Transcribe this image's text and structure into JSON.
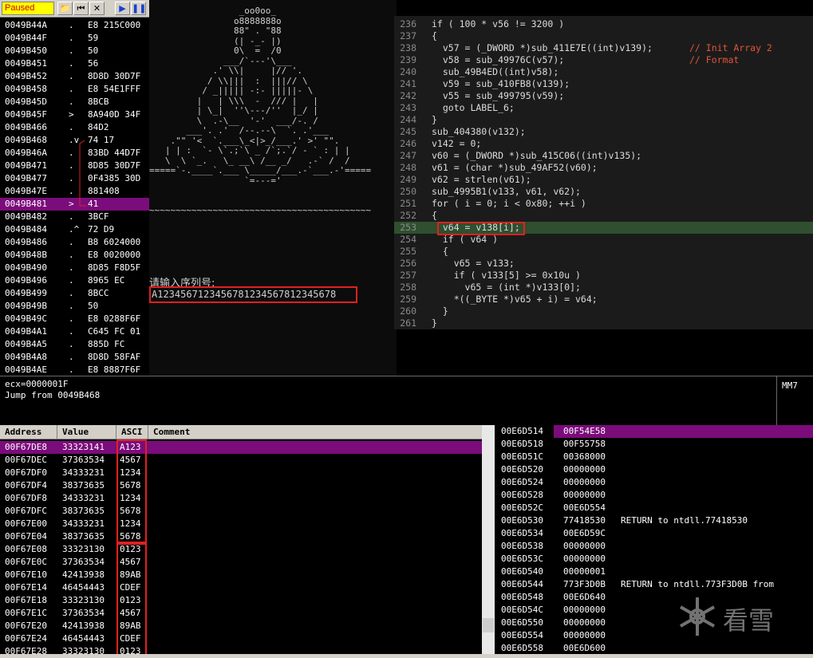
{
  "toolbar": {
    "status": "Paused",
    "icons": [
      "open-icon",
      "rewind-icon",
      "close-icon",
      "run-icon",
      "pause-icon"
    ]
  },
  "disasm": [
    {
      "addr": "0049B44A",
      "mark": ".",
      "bytes": "E8 215C000"
    },
    {
      "addr": "0049B44F",
      "mark": ".",
      "bytes": "59"
    },
    {
      "addr": "0049B450",
      "mark": ".",
      "bytes": "50"
    },
    {
      "addr": "0049B451",
      "mark": ".",
      "bytes": "56"
    },
    {
      "addr": "0049B452",
      "mark": ".",
      "bytes": "8D8D 30D7F"
    },
    {
      "addr": "0049B458",
      "mark": ".",
      "bytes": "E8 54E1FFF"
    },
    {
      "addr": "0049B45D",
      "mark": ".",
      "bytes": "8BCB"
    },
    {
      "addr": "0049B45F",
      "mark": ">",
      "bytes": "8A940D 34F"
    },
    {
      "addr": "0049B466",
      "mark": ".",
      "bytes": "84D2"
    },
    {
      "addr": "0049B468",
      "mark": ".v",
      "bytes": "74 17"
    },
    {
      "addr": "0049B46A",
      "mark": ".",
      "bytes": "83BD 44D7F"
    },
    {
      "addr": "0049B471",
      "mark": ".",
      "bytes": "8D85 30D7F"
    },
    {
      "addr": "0049B477",
      "mark": ".",
      "bytes": "0F4385 30D"
    },
    {
      "addr": "0049B47E",
      "mark": ".",
      "bytes": "881408"
    },
    {
      "addr": "0049B481",
      "mark": ">",
      "bytes": "41"
    },
    {
      "addr": "0049B482",
      "mark": ".",
      "bytes": "3BCF"
    },
    {
      "addr": "0049B484",
      "mark": ".^",
      "bytes": "72 D9"
    },
    {
      "addr": "0049B486",
      "mark": ".",
      "bytes": "B8 6024000"
    },
    {
      "addr": "0049B48B",
      "mark": ".",
      "bytes": "E8 0020000"
    },
    {
      "addr": "0049B490",
      "mark": ".",
      "bytes": "8D85 F8D5F"
    },
    {
      "addr": "0049B496",
      "mark": ".",
      "bytes": "8965 EC"
    },
    {
      "addr": "0049B499",
      "mark": ".",
      "bytes": "8BCC"
    },
    {
      "addr": "0049B49B",
      "mark": ".",
      "bytes": "50"
    },
    {
      "addr": "0049B49C",
      "mark": ".",
      "bytes": "E8 0288F6F"
    },
    {
      "addr": "0049B4A1",
      "mark": ".",
      "bytes": "C645 FC 01"
    },
    {
      "addr": "0049B4A5",
      "mark": ".",
      "bytes": "885D FC"
    },
    {
      "addr": "0049B4A8",
      "mark": ".",
      "bytes": "8D8D 58FAF"
    },
    {
      "addr": "0049B4AE",
      "mark": ".",
      "bytes": "E8 8887F6F"
    }
  ],
  "console": {
    "banner": "                 _oo0oo_\n                o8888888o\n                88\" . \"88\n                (| -_- |)\n                0\\  =  /0\n              ___/`---'\\___\n            .' \\\\|     |// '.\n           / \\\\|||  :  |||// \\\n          / _||||| -:- |||||- \\\n         |   | \\\\\\  -  /// |   |\n         | \\_|  ''\\---/''  |_/ |\n         \\  .-\\__  '-'  ___/-. /\n       ___'. .'  /--.--\\  `. .'___\n    .\"\" '<  `.___\\_<|>_/___.' >' \"\".\n   | | :  `- \\`.;`\\ _ /`;.`/ - ` : | |\n   \\  \\ `_.   \\_ __\\ /__ _/   .-` /  /\n=====`-.____`.___ \\_____/___.-`___.-'=====\n                  `=---='\n\n\n~~~~~~~~~~~~~~~~~~~~~~~~~~~~~~~~~~~~~~~~~~",
    "prompt": "请输入序列号:",
    "serial": "A1234567123456781234567812345678"
  },
  "code": [
    {
      "n": "236",
      "t": "if ( 100 * v56 != 3200 )"
    },
    {
      "n": "237",
      "t": "{"
    },
    {
      "n": "238",
      "t": "  v57 = (_DWORD *)sub_411E7E((int)v139);",
      "c": "// Init Array 2"
    },
    {
      "n": "239",
      "t": "  v58 = sub_49976C(v57);",
      "c": "// Format"
    },
    {
      "n": "240",
      "t": "  sub_49B4ED((int)v58);"
    },
    {
      "n": "241",
      "t": "  v59 = sub_410FB8(v139);"
    },
    {
      "n": "242",
      "t": "  v55 = sub_499795(v59);"
    },
    {
      "n": "243",
      "t": "  goto LABEL_6;"
    },
    {
      "n": "244",
      "t": "}"
    },
    {
      "n": "245",
      "t": "sub_404380(v132);"
    },
    {
      "n": "246",
      "t": "v142 = 0;"
    },
    {
      "n": "247",
      "t": "v60 = (_DWORD *)sub_415C06((int)v135);"
    },
    {
      "n": "248",
      "t": "v61 = (char *)sub_49AF52(v60);"
    },
    {
      "n": "249",
      "t": "v62 = strlen(v61);"
    },
    {
      "n": "250",
      "t": "sub_4995B1(v133, v61, v62);"
    },
    {
      "n": "251",
      "t": "for ( i = 0; i < 0x80; ++i )"
    },
    {
      "n": "252",
      "t": "{"
    },
    {
      "n": "253",
      "t": "  v64 = v138[i];"
    },
    {
      "n": "254",
      "t": "  if ( v64 )"
    },
    {
      "n": "255",
      "t": "  {"
    },
    {
      "n": "256",
      "t": "    v65 = v133;"
    },
    {
      "n": "257",
      "t": "    if ( v133[5] >= 0x10u )"
    },
    {
      "n": "258",
      "t": "      v65 = (int *)v133[0];"
    },
    {
      "n": "259",
      "t": "    *((_BYTE *)v65 + i) = v64;"
    },
    {
      "n": "260",
      "t": "  }"
    },
    {
      "n": "261",
      "t": "}"
    }
  ],
  "info": {
    "line1": "ecx=0000001F",
    "line2": "Jump from 0049B468",
    "reg": "MM7"
  },
  "dump": {
    "headers": [
      "Address",
      "Value",
      "ASCI",
      "Comment"
    ],
    "rows": [
      {
        "addr": "00F67DE8",
        "val": "33323141",
        "ascii": "A123"
      },
      {
        "addr": "00F67DEC",
        "val": "37363534",
        "ascii": "4567"
      },
      {
        "addr": "00F67DF0",
        "val": "34333231",
        "ascii": "1234"
      },
      {
        "addr": "00F67DF4",
        "val": "38373635",
        "ascii": "5678"
      },
      {
        "addr": "00F67DF8",
        "val": "34333231",
        "ascii": "1234"
      },
      {
        "addr": "00F67DFC",
        "val": "38373635",
        "ascii": "5678"
      },
      {
        "addr": "00F67E00",
        "val": "34333231",
        "ascii": "1234"
      },
      {
        "addr": "00F67E04",
        "val": "38373635",
        "ascii": "5678"
      },
      {
        "addr": "00F67E08",
        "val": "33323130",
        "ascii": "0123"
      },
      {
        "addr": "00F67E0C",
        "val": "37363534",
        "ascii": "4567"
      },
      {
        "addr": "00F67E10",
        "val": "42413938",
        "ascii": "89AB"
      },
      {
        "addr": "00F67E14",
        "val": "46454443",
        "ascii": "CDEF"
      },
      {
        "addr": "00F67E18",
        "val": "33323130",
        "ascii": "0123"
      },
      {
        "addr": "00F67E1C",
        "val": "37363534",
        "ascii": "4567"
      },
      {
        "addr": "00F67E20",
        "val": "42413938",
        "ascii": "89AB"
      },
      {
        "addr": "00F67E24",
        "val": "46454443",
        "ascii": "CDEF"
      },
      {
        "addr": "00F67E28",
        "val": "33323130",
        "ascii": "0123"
      }
    ]
  },
  "stack": [
    {
      "addr": "00E6D514",
      "val": "00F54E58",
      "c": ""
    },
    {
      "addr": "00E6D518",
      "val": "00F55758",
      "c": ""
    },
    {
      "addr": "00E6D51C",
      "val": "00368000",
      "c": ""
    },
    {
      "addr": "00E6D520",
      "val": "00000000",
      "c": ""
    },
    {
      "addr": "00E6D524",
      "val": "00000000",
      "c": ""
    },
    {
      "addr": "00E6D528",
      "val": "00000000",
      "c": ""
    },
    {
      "addr": "00E6D52C",
      "val": "00E6D554",
      "c": ""
    },
    {
      "addr": "00E6D530",
      "val": "77418530",
      "c": "RETURN to ntdll.77418530"
    },
    {
      "addr": "00E6D534",
      "val": "00E6D59C",
      "c": ""
    },
    {
      "addr": "00E6D538",
      "val": "00000000",
      "c": ""
    },
    {
      "addr": "00E6D53C",
      "val": "00000000",
      "c": ""
    },
    {
      "addr": "00E6D540",
      "val": "00000001",
      "c": ""
    },
    {
      "addr": "00E6D544",
      "val": "773F3D0B",
      "c": "RETURN to ntdll.773F3D0B from"
    },
    {
      "addr": "00E6D548",
      "val": "00E6D640",
      "c": ""
    },
    {
      "addr": "00E6D54C",
      "val": "00000000",
      "c": ""
    },
    {
      "addr": "00E6D550",
      "val": "00000000",
      "c": ""
    },
    {
      "addr": "00E6D554",
      "val": "00000000",
      "c": ""
    },
    {
      "addr": "00E6D558",
      "val": "00E6D600",
      "c": ""
    }
  ],
  "watermark": "看雪"
}
